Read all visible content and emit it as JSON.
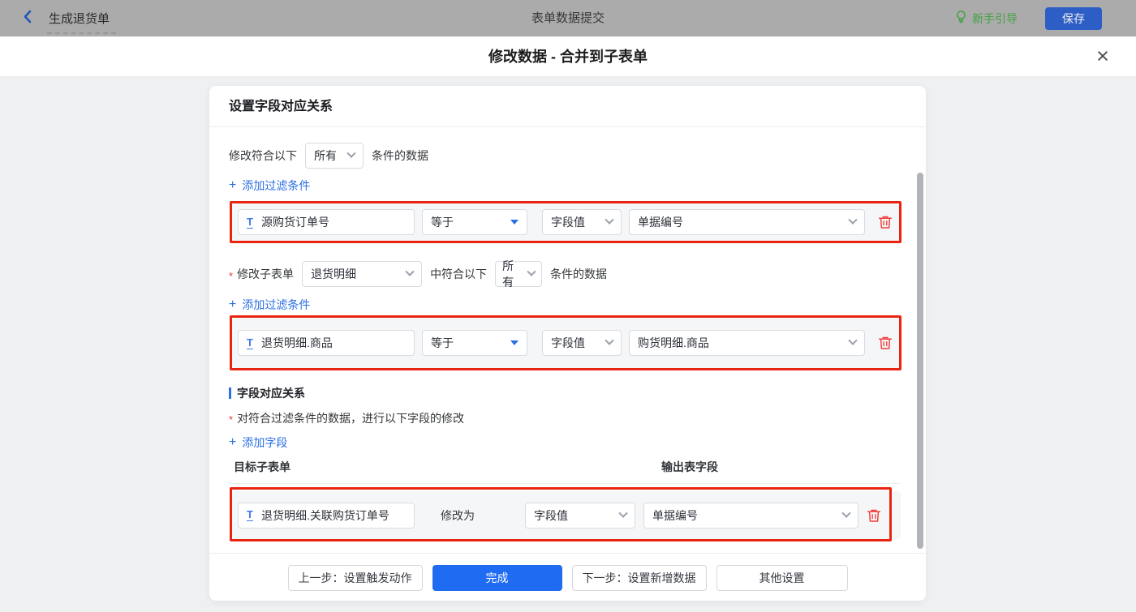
{
  "topbar": {
    "back_label": "生成退货单",
    "center_title": "表单数据提交",
    "guide_label": "新手引导",
    "save_label": "保存"
  },
  "modal": {
    "title": "修改数据 - 合并到子表单"
  },
  "card": {
    "header_title": "设置字段对应关系",
    "filter1": {
      "prefix": "修改符合以下",
      "match_value": "所有",
      "suffix": "条件的数据",
      "add_label": "添加过滤条件"
    },
    "row1": {
      "field": "源购货订单号",
      "operator": "等于",
      "value_type": "字段值",
      "value": "单据编号"
    },
    "filter2": {
      "required_mark": "*",
      "label": "修改子表单",
      "subform_value": "退货明细",
      "middle": "中符合以下",
      "match_value": "所有",
      "suffix": "条件的数据",
      "add_label": "添加过滤条件"
    },
    "row2": {
      "field": "退货明细.商品",
      "operator": "等于",
      "value_type": "字段值",
      "value": "购货明细.商品"
    },
    "mapping": {
      "section_title": "字段对应关系",
      "required_mark": "*",
      "desc": "对符合过滤条件的数据，进行以下字段的修改",
      "add_label": "添加字段",
      "col_left": "目标子表单",
      "col_right": "输出表字段"
    },
    "row3": {
      "field": "退货明细.关联购货订单号",
      "action": "修改为",
      "value_type": "字段值",
      "value": "单据编号"
    },
    "footer": {
      "prev": "上一步：设置触发动作",
      "done": "完成",
      "next": "下一步：设置新增数据",
      "other": "其他设置"
    }
  },
  "icons": {
    "plus": "+",
    "close": "×",
    "text_field": "T"
  },
  "colors": {
    "accent_blue": "#2970e6",
    "done_button_blue": "#1f6bf2",
    "save_button_blue": "#2c5ec6",
    "annotation_red": "#e92512",
    "danger_red": "#f23c3c",
    "guide_green": "#44a044",
    "panel_gray": "#f5f6f7",
    "body_gray": "#eef0f2",
    "topbar_gray": "#ababab"
  }
}
